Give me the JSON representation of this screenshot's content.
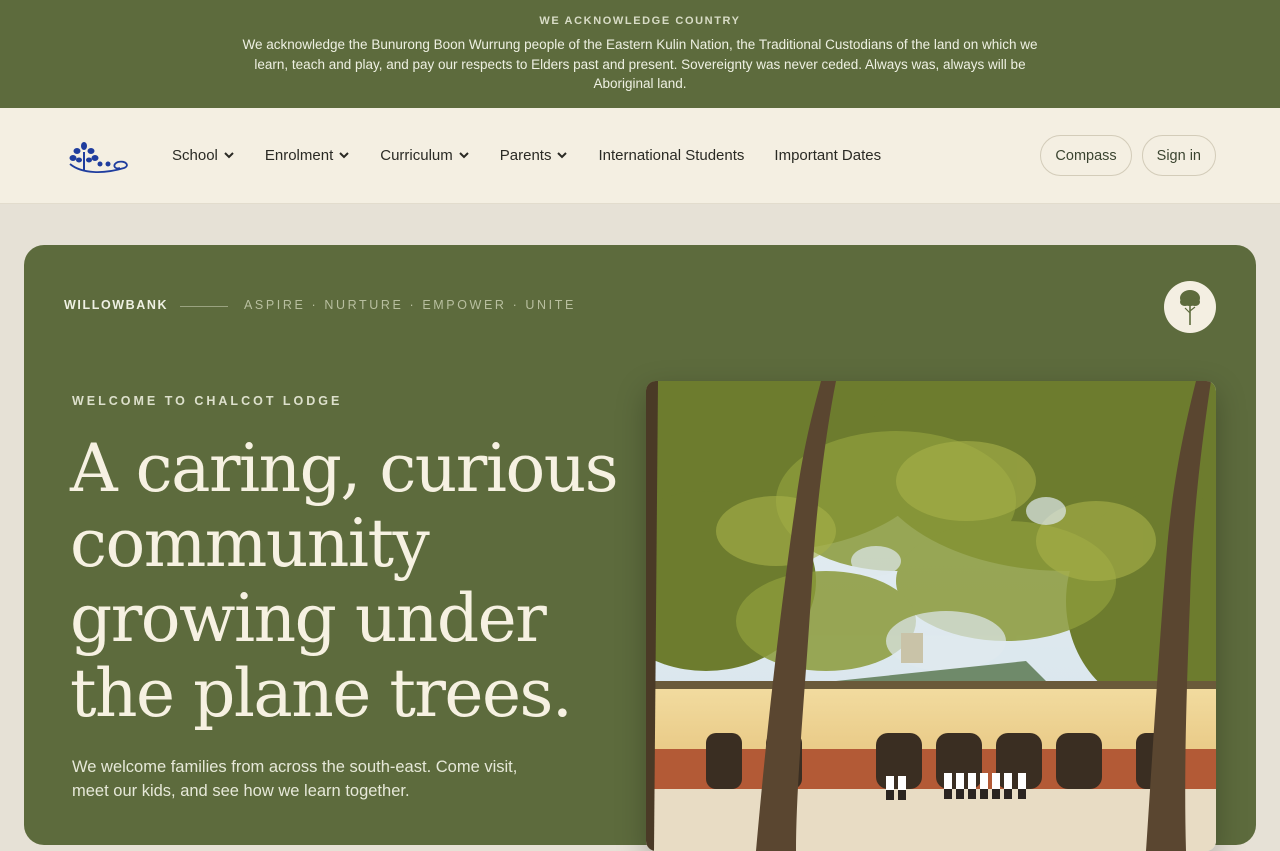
{
  "acknowledgement": {
    "title": "WE ACKNOWLEDGE COUNTRY",
    "text": "We acknowledge the Bunurong Boon Wurrung people of the Eastern Kulin Nation, the Traditional Custodians of the land on which we learn, teach and play, and pay our respects to Elders past and present. Sovereignty was never ceded. Always was, always will be Aboriginal land."
  },
  "nav": {
    "logo_icon": "school-tree-logo",
    "items": [
      {
        "label": "School",
        "dropdown": true
      },
      {
        "label": "Enrolment",
        "dropdown": true
      },
      {
        "label": "Curriculum",
        "dropdown": true
      },
      {
        "label": "Parents",
        "dropdown": true
      },
      {
        "label": "International Students",
        "dropdown": false
      },
      {
        "label": "Important Dates",
        "dropdown": false
      }
    ],
    "compass_label": "Compass",
    "signin_label": "Sign in"
  },
  "hero": {
    "brand": "WILLOWBANK",
    "motto": "ASPIRE · NURTURE · EMPOWER · UNITE",
    "badge_icon": "tree-icon",
    "eyebrow": "WELCOME TO CHALCOT LODGE",
    "headline": "A caring, curious community growing under the plane trees.",
    "lede": "We welcome families from across the south-east. Come visit, meet our kids, and see how we learn together."
  },
  "colors": {
    "primary": "#5d6b3d",
    "cream": "#f4efe2",
    "background": "#e6e1d6",
    "logo_blue": "#1f3d9e"
  }
}
